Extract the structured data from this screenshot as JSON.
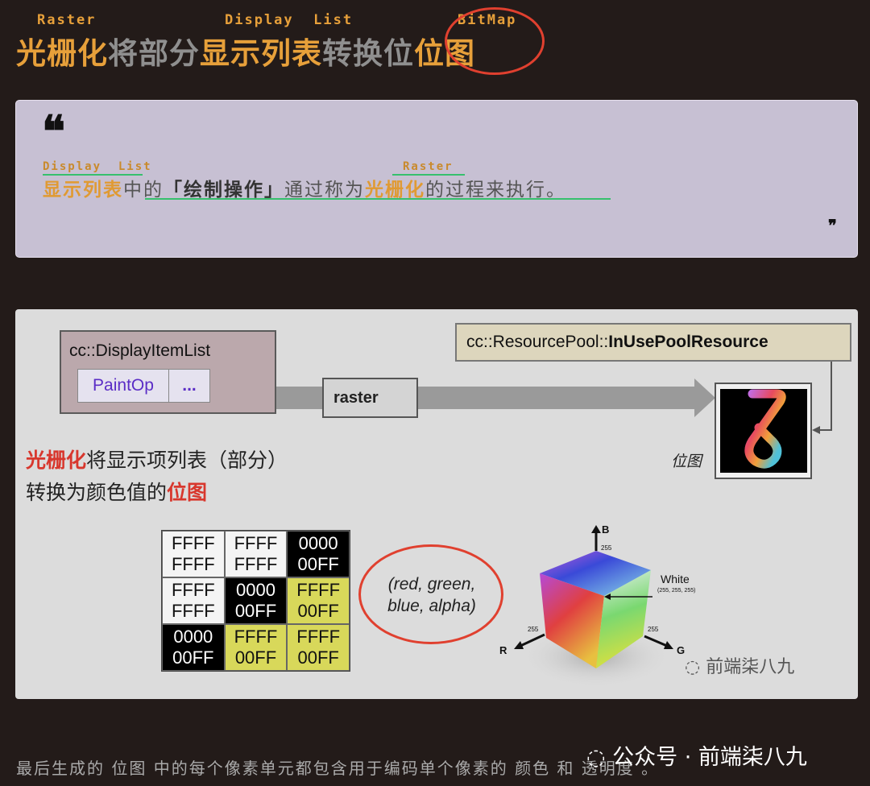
{
  "title": {
    "part1": "光栅化",
    "part2": "将部分",
    "part3": "显示列表",
    "part4": "转换位",
    "part5": "位图",
    "ruby_raster": "Raster",
    "ruby_display_list": "Display  List",
    "ruby_bitmap": "BitMap"
  },
  "quote": {
    "ruby_display_list": "Display  List",
    "ruby_raster": "Raster",
    "seg1": "显示列表",
    "seg2": "中的",
    "seg3": "「绘制操作」",
    "seg4": "通过称为",
    "seg5": "光栅化",
    "seg6": "的过程来执行。",
    "open_mark": "❝",
    "close_mark": "❞"
  },
  "diagram": {
    "display_item_list": "cc::DisplayItemList",
    "paint_op": "PaintOp",
    "more": "...",
    "raster": "raster",
    "resource_pool_prefix": "cc::ResourcePool::",
    "resource_pool_name": "InUsePoolResource",
    "bitmap_label": "位图",
    "desc_line1_hl": "光栅化",
    "desc_line1_rest": "将显示项列表（部分）",
    "desc_line2_rest": "转换为颜色值的",
    "desc_line2_hl": "位图",
    "grid": [
      {
        "top": "FFFF",
        "bottom": "FFFF",
        "color": "white"
      },
      {
        "top": "FFFF",
        "bottom": "FFFF",
        "color": "white"
      },
      {
        "top": "0000",
        "bottom": "00FF",
        "color": "black"
      },
      {
        "top": "FFFF",
        "bottom": "FFFF",
        "color": "white"
      },
      {
        "top": "0000",
        "bottom": "00FF",
        "color": "black"
      },
      {
        "top": "FFFF",
        "bottom": "00FF",
        "color": "yellow"
      },
      {
        "top": "0000",
        "bottom": "00FF",
        "color": "black"
      },
      {
        "top": "FFFF",
        "bottom": "00FF",
        "color": "yellow"
      },
      {
        "top": "FFFF",
        "bottom": "00FF",
        "color": "yellow"
      }
    ],
    "rgba_line1": "(red, green,",
    "rgba_line2": "blue, alpha)",
    "cube": {
      "b_label": "B",
      "b_value": "255",
      "r_label": "R",
      "r_value": "255",
      "g_label": "G",
      "g_value": "255",
      "white_label": "White",
      "white_value": "(255, 255, 255)"
    },
    "watermark": "前端柒八九"
  },
  "footer": {
    "watermark": "公众号 · 前端柒八九",
    "text": "最后生成的 位图 中的每个像素单元都包含用于编码单个像素的 颜色 和 透明度 。"
  },
  "colors": {
    "accent": "#e7a03a",
    "red": "#d8372d",
    "green": "#36c06d",
    "background": "#231b19"
  }
}
